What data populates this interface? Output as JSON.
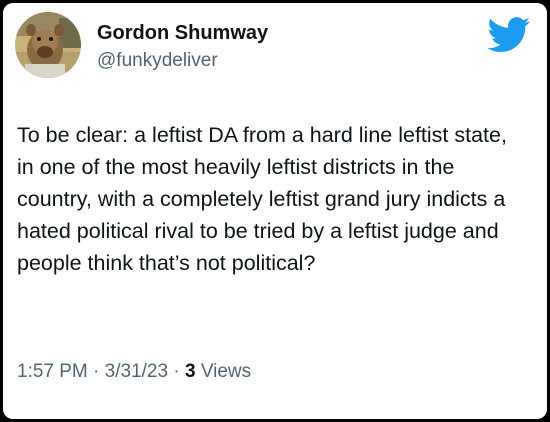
{
  "author": {
    "display_name": "Gordon Shumway",
    "handle": "@funkydeliver",
    "avatar_icon": "alf-avatar"
  },
  "brand": {
    "icon": "twitter-bird-icon",
    "color": "#1d9bf0"
  },
  "tweet": {
    "text": "To be clear: a leftist DA from a hard line leftist state, in one of the most heavily leftist districts in the country, with a completely leftist grand jury indicts a hated political rival to be tried by a leftist judge and people think that’s not political?"
  },
  "meta": {
    "time": "1:57 PM",
    "separator": " · ",
    "date": "3/31/23",
    "views_count": "3",
    "views_label": "Views"
  },
  "colors": {
    "text_primary": "#0f1419",
    "text_secondary": "#536471",
    "background": "#ffffff",
    "frame": "#000000"
  }
}
